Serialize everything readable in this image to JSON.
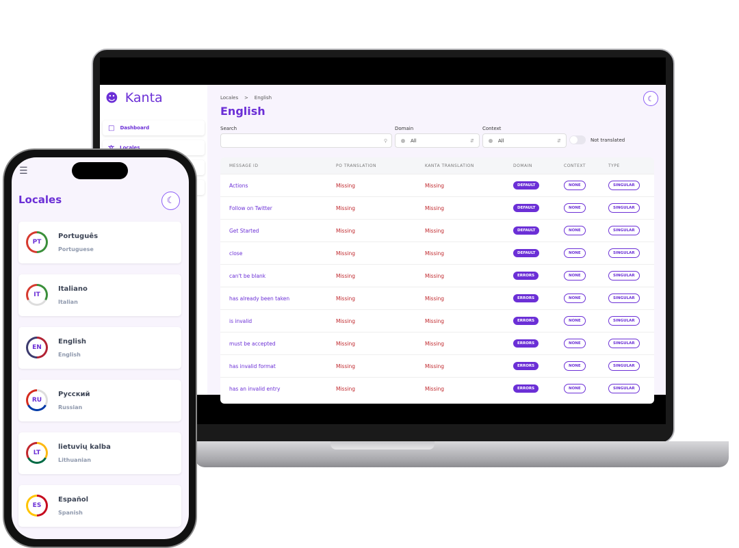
{
  "app": {
    "name": "Kanta",
    "accent": "#6b2fd6",
    "missing_color": "#c0282d"
  },
  "sidebar": {
    "items": [
      {
        "label": "Dashboard",
        "icon": "dashboard-icon"
      },
      {
        "label": "Locales",
        "icon": "translate-icon"
      }
    ]
  },
  "breadcrumb": {
    "root": "Locales",
    "separator": ">",
    "current": "English"
  },
  "page_title": "English",
  "filters": {
    "search_label": "Search",
    "search_value": "",
    "domain_label": "Domain",
    "domain_value": "All",
    "context_label": "Context",
    "context_value": "All",
    "toggle_label": "Not translated",
    "toggle_on": false
  },
  "table": {
    "headers": [
      "MESSAGE ID",
      "PO TRANSLATION",
      "KANTA TRANSLATION",
      "DOMAIN",
      "CONTEXT",
      "TYPE"
    ],
    "rows": [
      [
        "Actions",
        "Missing",
        "Missing",
        "DEFAULT",
        "NONE",
        "SINGULAR"
      ],
      [
        "Follow on Twitter",
        "Missing",
        "Missing",
        "DEFAULT",
        "NONE",
        "SINGULAR"
      ],
      [
        "Get Started",
        "Missing",
        "Missing",
        "DEFAULT",
        "NONE",
        "SINGULAR"
      ],
      [
        "close",
        "Missing",
        "Missing",
        "DEFAULT",
        "NONE",
        "SINGULAR"
      ],
      [
        "can't be blank",
        "Missing",
        "Missing",
        "ERRORS",
        "NONE",
        "SINGULAR"
      ],
      [
        "has already been taken",
        "Missing",
        "Missing",
        "ERRORS",
        "NONE",
        "SINGULAR"
      ],
      [
        "is invalid",
        "Missing",
        "Missing",
        "ERRORS",
        "NONE",
        "SINGULAR"
      ],
      [
        "must be accepted",
        "Missing",
        "Missing",
        "ERRORS",
        "NONE",
        "SINGULAR"
      ],
      [
        "has invalid format",
        "Missing",
        "Missing",
        "ERRORS",
        "NONE",
        "SINGULAR"
      ],
      [
        "has an invalid entry",
        "Missing",
        "Missing",
        "ERRORS",
        "NONE",
        "SINGULAR"
      ]
    ]
  },
  "phone": {
    "title": "Locales",
    "locales": [
      {
        "code": "PT",
        "name": "Português",
        "english": "Portuguese",
        "colors": [
          "#3a8f3a",
          "#d63a2f"
        ]
      },
      {
        "code": "IT",
        "name": "Italiano",
        "english": "Italian",
        "colors": [
          "#3a8f3a",
          "#dddddd",
          "#d63a2f"
        ]
      },
      {
        "code": "EN",
        "name": "English",
        "english": "English",
        "colors": [
          "#b22234",
          "#3c3b6e"
        ]
      },
      {
        "code": "RU",
        "name": "Русский",
        "english": "Russian",
        "colors": [
          "#dddddd",
          "#0039a6",
          "#d52b1e"
        ]
      },
      {
        "code": "LT",
        "name": "lietuvių kalba",
        "english": "Lithuanian",
        "colors": [
          "#fdb913",
          "#006a44",
          "#c1272d"
        ]
      },
      {
        "code": "ES",
        "name": "Español",
        "english": "Spanish",
        "colors": [
          "#c60b1e",
          "#ffc400"
        ]
      }
    ]
  }
}
